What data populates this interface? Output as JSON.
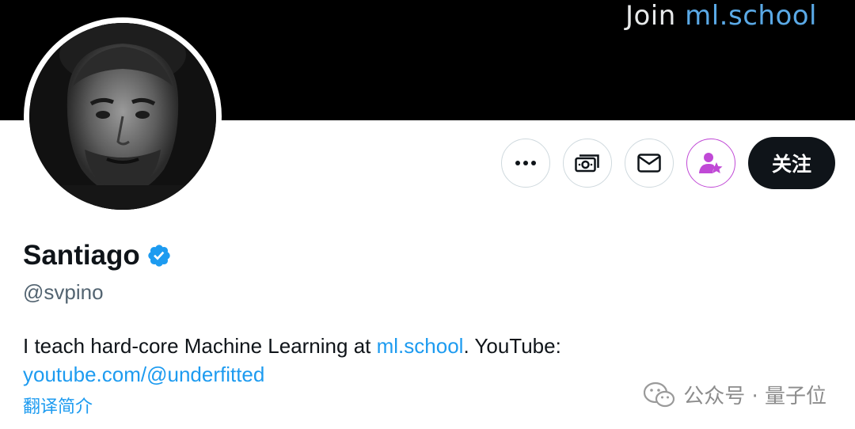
{
  "banner": {
    "prefix": "Join ",
    "link": "ml.school"
  },
  "actions": {
    "more_icon": "more-horizontal-icon",
    "tip_icon": "money-icon",
    "message_icon": "mail-icon",
    "subscribe_icon": "user-star-icon",
    "follow_label": "关注"
  },
  "profile": {
    "name": "Santiago",
    "verified_icon": "verified-badge-icon",
    "handle": "@svpino",
    "bio_text_1": "I teach hard-core Machine Learning at ",
    "bio_link_1": "ml.school",
    "bio_text_2": ". YouTube:",
    "bio_link_2": "youtube.com/@underfitted",
    "translate_label": "翻译简介"
  },
  "watermark": {
    "text": "公众号 · 量子位"
  },
  "colors": {
    "accent": "#1d9bf0",
    "purple": "#c049d6",
    "dark": "#0f1419"
  }
}
